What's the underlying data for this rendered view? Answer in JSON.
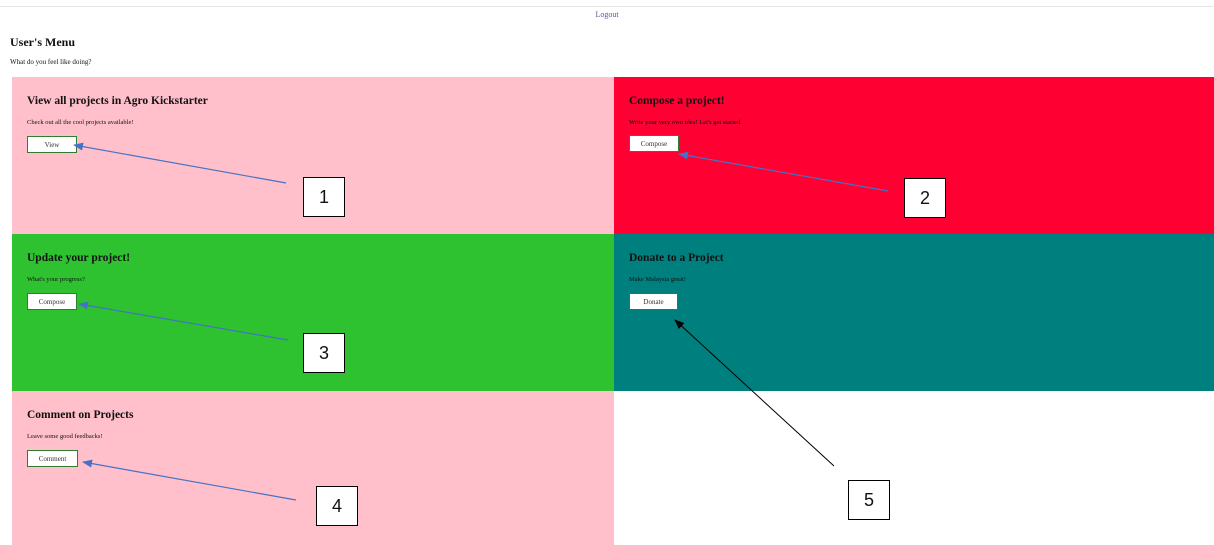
{
  "header": {
    "logout_label": "Logout",
    "title": "User's Menu",
    "subtitle": "What do you feel like doing?"
  },
  "cards": [
    {
      "title": "View all projects in Agro Kickstarter",
      "description": "Check out all the cool projects available!",
      "button_label": "View",
      "color": "#ffc0cb"
    },
    {
      "title": "Compose a project!",
      "description": "Write your very own idea! Let's get started.",
      "button_label": "Compose",
      "color": "#ff0033"
    },
    {
      "title": "Update your project!",
      "description": "What's your progress?",
      "button_label": "Compose",
      "color": "#2ec231"
    },
    {
      "title": "Donate to a Project",
      "description": "Make Malaysia great!",
      "button_label": "Donate",
      "color": "#007f7f"
    },
    {
      "title": "Comment on Projects",
      "description": "Leave some good feedbacks!",
      "button_label": "Comment",
      "color": "#ffc0cb"
    }
  ],
  "annotations": {
    "labels": [
      "1",
      "2",
      "3",
      "4",
      "5"
    ],
    "arrow_color_blue": "#4472c4",
    "arrow_color_black": "#000000"
  }
}
